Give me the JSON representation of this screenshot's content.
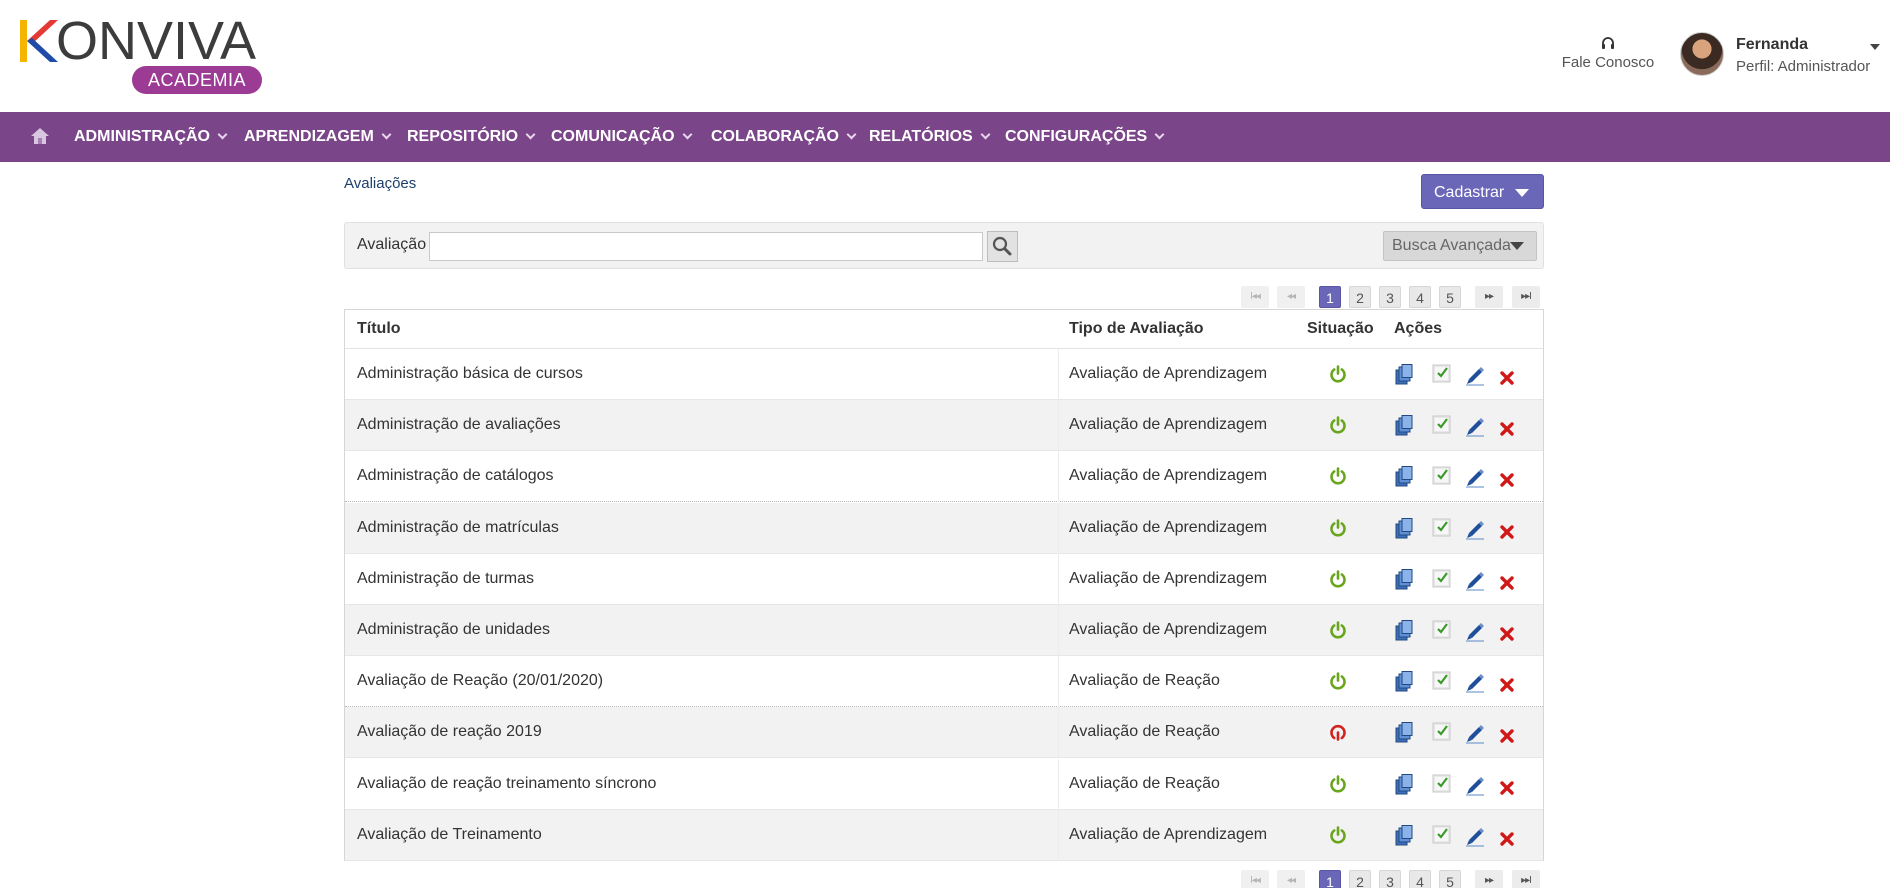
{
  "header": {
    "brand_main": "ONVIVA",
    "brand_sub": "ACADEMIA",
    "contact_label": "Fale Conosco",
    "user_name": "Fernanda",
    "user_role": "Perfil: Administrador"
  },
  "nav": {
    "items": [
      {
        "label": "ADMINISTRAÇÃO"
      },
      {
        "label": "APRENDIZAGEM"
      },
      {
        "label": "REPOSITÓRIO"
      },
      {
        "label": "COMUNICAÇÃO"
      },
      {
        "label": "COLABORAÇÃO"
      },
      {
        "label": "RELATÓRIOS"
      },
      {
        "label": "CONFIGURAÇÕES"
      }
    ]
  },
  "page": {
    "breadcrumb": "Avaliações",
    "register_label": "Cadastrar",
    "search_label": "Avaliação",
    "search_value": "",
    "advanced_search_label": "Busca Avançada"
  },
  "pager": {
    "first": "I◂◂",
    "prev": "◂◂",
    "next": "▸▸",
    "last": "▸▸I",
    "pages": [
      "1",
      "2",
      "3",
      "4",
      "5"
    ],
    "current": "1"
  },
  "table": {
    "headers": {
      "title": "Título",
      "type": "Tipo de Avaliação",
      "status": "Situação",
      "actions": "Ações"
    },
    "rows": [
      {
        "title": "Administração básica de cursos",
        "type": "Avaliação de Aprendizagem",
        "active": true
      },
      {
        "title": "Administração de avaliações",
        "type": "Avaliação de Aprendizagem",
        "active": true
      },
      {
        "title": "Administração de catálogos",
        "type": "Avaliação de Aprendizagem",
        "active": true
      },
      {
        "title": "Administração de matrículas",
        "type": "Avaliação de Aprendizagem",
        "active": true
      },
      {
        "title": "Administração de turmas",
        "type": "Avaliação de Aprendizagem",
        "active": true
      },
      {
        "title": "Administração de unidades",
        "type": "Avaliação de Aprendizagem",
        "active": true
      },
      {
        "title": "Avaliação de Reação (20/01/2020)",
        "type": "Avaliação de Reação",
        "active": true
      },
      {
        "title": "Avaliação de reação 2019",
        "type": "Avaliação de Reação",
        "active": false
      },
      {
        "title": "Avaliação de reação treinamento síncrono",
        "type": "Avaliação de Reação",
        "active": true
      },
      {
        "title": "Avaliação de Treinamento",
        "type": "Avaliação de Aprendizagem",
        "active": true
      }
    ]
  },
  "icons": {
    "home": "home-icon",
    "contact": "headset-icon",
    "search": "magnifier-icon",
    "status_active": "power-on-icon",
    "status_inactive": "power-off-icon",
    "copy": "copy-icon",
    "check": "check-sheet-icon",
    "edit": "pencil-icon",
    "delete": "delete-x-icon"
  },
  "colors": {
    "nav_bg": "#7b4589",
    "accent": "#6a66b8",
    "brand_badge": "#9b3b94",
    "status_active": "#6aa51e",
    "status_inactive": "#d0231e",
    "delete": "#d01818"
  }
}
